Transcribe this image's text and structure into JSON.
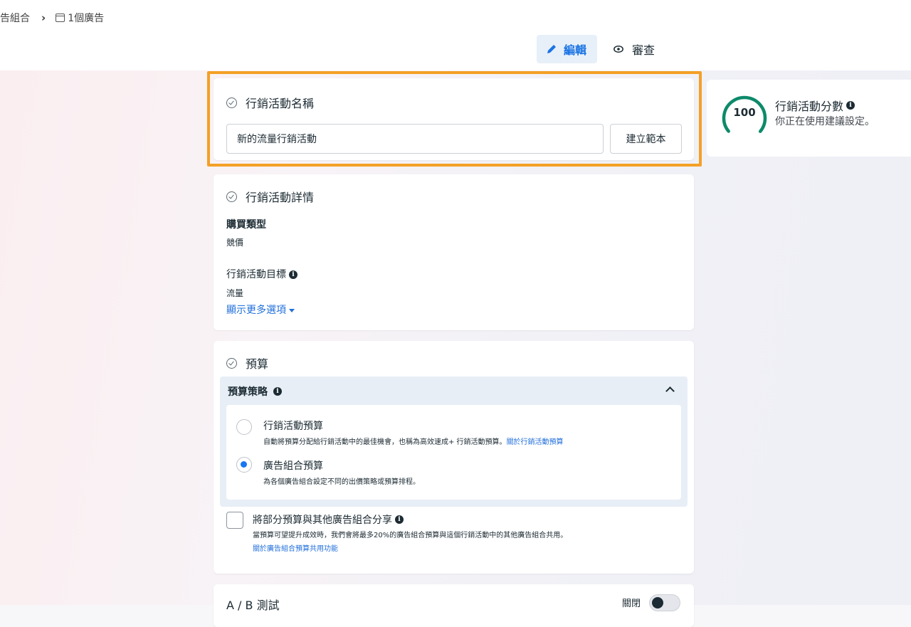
{
  "breadcrumb": {
    "ad_set": "告組合",
    "ads": "1個廣告"
  },
  "mode_tabs": {
    "edit": "編輯",
    "review": "審查"
  },
  "campaign_name": {
    "title": "行銷活動名稱",
    "input_value": "新的流量行銷活動",
    "template_button": "建立範本"
  },
  "campaign_details": {
    "title": "行銷活動詳情",
    "buying_type_label": "購買類型",
    "buying_type_value": "競價",
    "objective_label": "行銷活動目標",
    "objective_value": "流量",
    "more_options": "顯示更多選項"
  },
  "budget": {
    "title": "預算",
    "strategy_label": "預算策略",
    "options": [
      {
        "title": "行銷活動預算",
        "desc": "自動將預算分配給行銷活動中的最佳機會，也稱為高效速成+ 行銷活動預算。",
        "link": "關於行銷活動預算",
        "selected": false
      },
      {
        "title": "廣告組合預算",
        "desc": "為各個廣告組合設定不同的出價策略或預算排程。",
        "selected": true
      }
    ],
    "share": {
      "title": "將部分預算與其他廣告組合分享",
      "desc": "當預算可望提升成效時，我們會將最多20%的廣告組合預算與這個行銷活動中的其他廣告組合共用。",
      "link": "關於廣告組合預算共用功能",
      "checked": false
    }
  },
  "ab_test": {
    "title": "A / B 測試",
    "state_label": "關閉",
    "on": false
  },
  "score": {
    "value": "100",
    "level": 1.0,
    "title": "行銷活動分數",
    "subtitle": "你正在使用建議設定。"
  },
  "colors": {
    "accent": "#1877f2",
    "highlight": "#f4a026",
    "score_ring": "#0d8a6a"
  },
  "icons": [
    "chevron-right-icon",
    "ad-icon",
    "pencil-icon",
    "eye-icon",
    "check-circle-icon",
    "info-icon",
    "caret-down-icon",
    "chevron-up-icon"
  ]
}
